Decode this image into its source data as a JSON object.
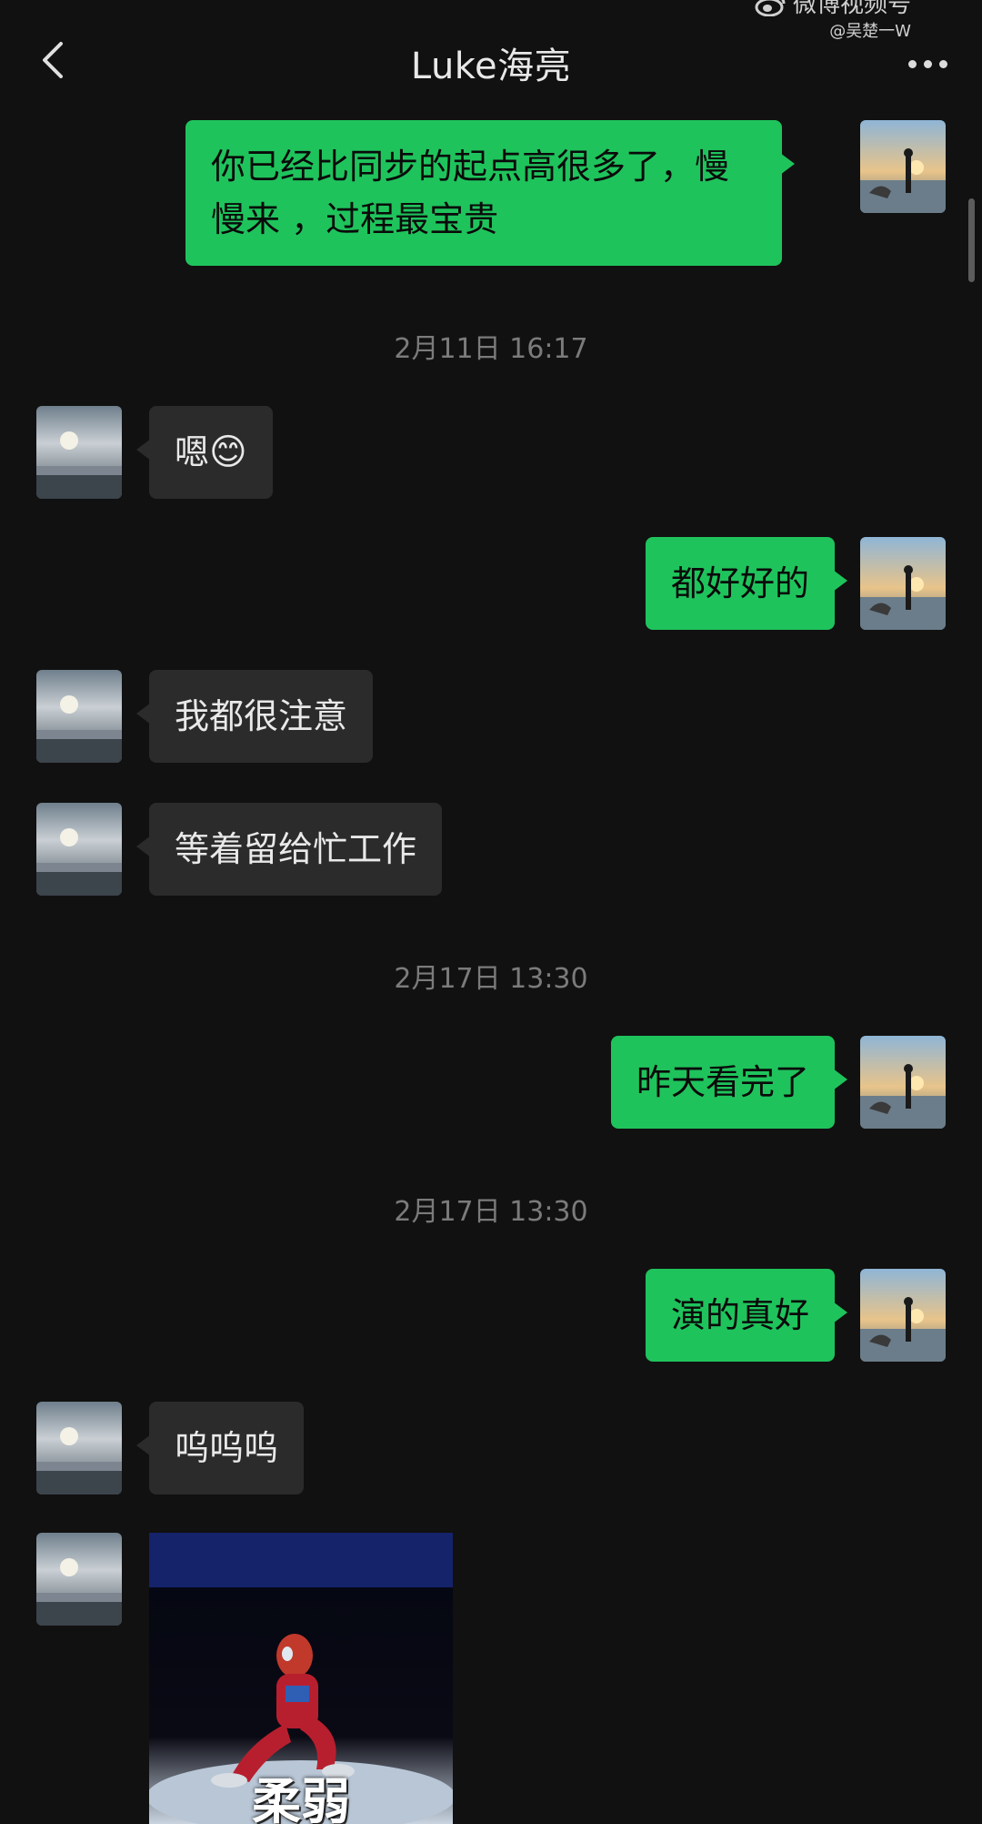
{
  "header": {
    "title": "Luke海亮",
    "back_icon": "chevron-left-icon",
    "more_icon": "more-dots-icon"
  },
  "watermark": {
    "platform": "微博视频号",
    "handle": "@吴楚一W"
  },
  "messages": [
    {
      "sender": "me",
      "text_line1": "你已经比同步的起点高很多了，慢",
      "text_line2": "慢来 ，过程最宝贵"
    },
    {
      "type": "timestamp",
      "text": "2月11日 16:17"
    },
    {
      "sender": "friend",
      "text": "嗯",
      "emoji": "😊"
    },
    {
      "sender": "me",
      "text": "都好好的"
    },
    {
      "sender": "friend",
      "text": "我都很注意"
    },
    {
      "sender": "friend",
      "text": "等着留给忙工作"
    },
    {
      "type": "timestamp",
      "text": "2月17日 13:30"
    },
    {
      "sender": "me",
      "text": "昨天看完了"
    },
    {
      "type": "timestamp",
      "text": "2月17日 13:30"
    },
    {
      "sender": "me",
      "text": "演的真好"
    },
    {
      "sender": "friend",
      "text": "呜呜呜"
    },
    {
      "sender": "friend",
      "type": "sticker",
      "caption": "柔弱"
    }
  ],
  "colors": {
    "background": "#111111",
    "my_bubble": "#1fc35c",
    "friend_bubble": "#2b2b2b",
    "timestamp_text": "#7b7b7b"
  }
}
